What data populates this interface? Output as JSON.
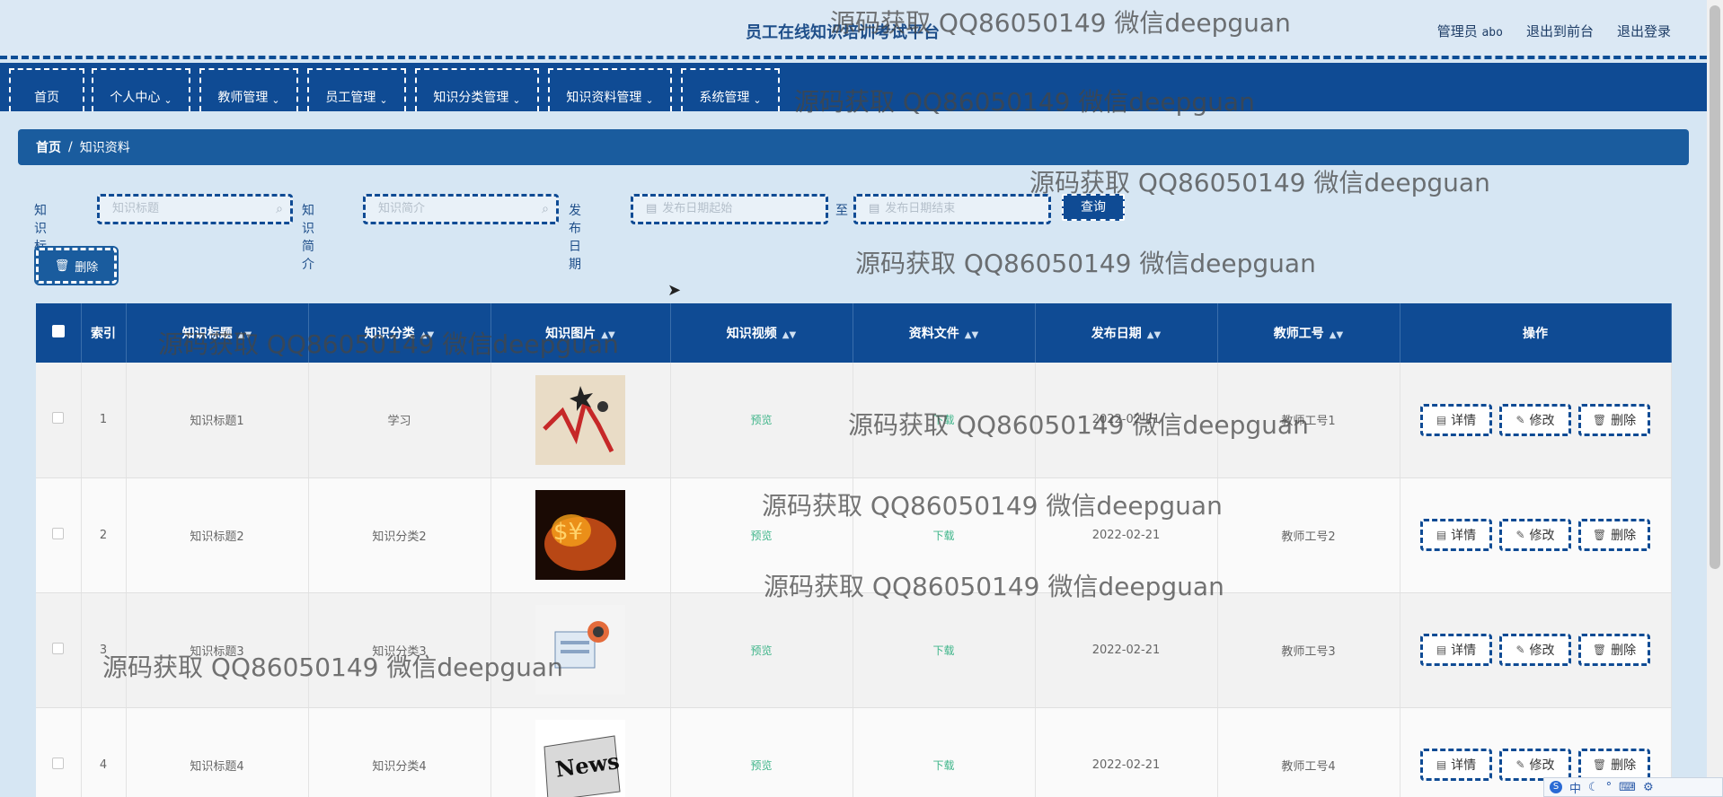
{
  "header": {
    "site_title": "员工在线知识培训考试平台",
    "role_label": "管理员",
    "username": "abo",
    "front_link": "退出到前台",
    "logout_link": "退出登录"
  },
  "nav": [
    {
      "label": "首页",
      "has_menu": false
    },
    {
      "label": "个人中心",
      "has_menu": true
    },
    {
      "label": "教师管理",
      "has_menu": true
    },
    {
      "label": "员工管理",
      "has_menu": true
    },
    {
      "label": "知识分类管理",
      "has_menu": true
    },
    {
      "label": "知识资料管理",
      "has_menu": true
    },
    {
      "label": "系统管理",
      "has_menu": true
    }
  ],
  "breadcrumb": {
    "home": "首页",
    "separator": "/",
    "current": "知识资料"
  },
  "search": {
    "title_label": "知识标题",
    "title_placeholder": "知识标题",
    "intro_label": "知识简介",
    "intro_placeholder": "知识简介",
    "date_label": "发布日期",
    "date_start_placeholder": "发布日期起始",
    "date_to": "至",
    "date_end_placeholder": "发布日期结束",
    "query_button": "查询"
  },
  "batch_delete_button": "删除",
  "table": {
    "columns": [
      "索引",
      "知识标题",
      "知识分类",
      "知识图片",
      "知识视频",
      "资料文件",
      "发布日期",
      "教师工号",
      "操作"
    ],
    "rows": [
      {
        "index": "1",
        "title": "知识标题1",
        "category": "学习",
        "image": "chart-crash-image",
        "video": "预览",
        "file": "下载",
        "date": "2022-02-21",
        "teacher": "教师工号1"
      },
      {
        "index": "2",
        "title": "知识标题2",
        "category": "知识分类2",
        "image": "money-fire-image",
        "video": "预览",
        "file": "下载",
        "date": "2022-02-21",
        "teacher": "教师工号2"
      },
      {
        "index": "3",
        "title": "知识标题3",
        "category": "知识分类3",
        "image": "news-icon-image",
        "video": "预览",
        "file": "下载",
        "date": "2022-02-21",
        "teacher": "教师工号3"
      },
      {
        "index": "4",
        "title": "知识标题4",
        "category": "知识分类4",
        "image": "newspaper-image",
        "video": "预览",
        "file": "下载",
        "date": "2022-02-21",
        "teacher": "教师工号4"
      }
    ],
    "actions": {
      "detail": "详情",
      "edit": "修改",
      "delete": "删除"
    }
  },
  "watermark_text": "源码获取 QQ86050149 微信deepguan",
  "ime": {
    "mode": "中"
  },
  "colors": {
    "primary": "#0f4b94",
    "breadcrumb": "#1a5c9e",
    "link_green": "#3fb58a",
    "background": "#d6e6f3"
  }
}
